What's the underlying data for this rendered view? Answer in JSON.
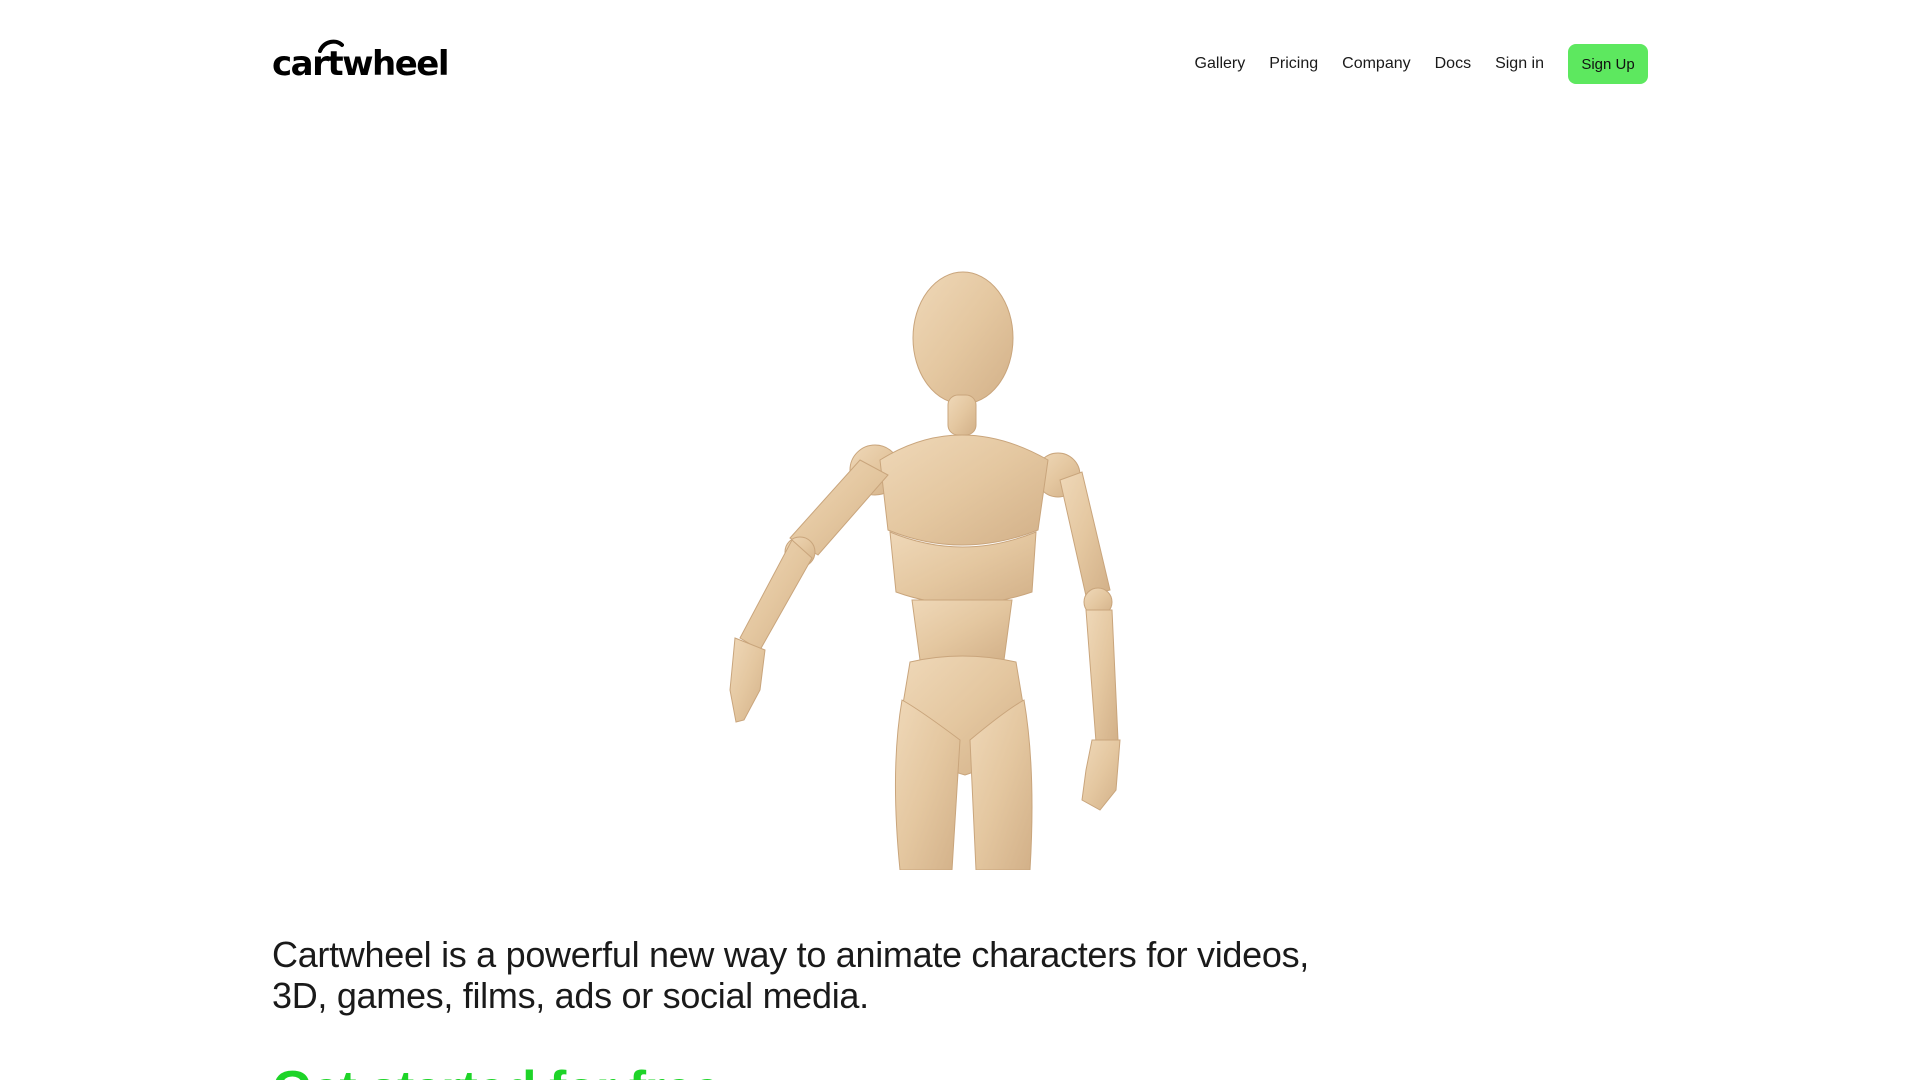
{
  "brand": {
    "logo_text": "cartwheel"
  },
  "nav": {
    "links": [
      "Gallery",
      "Pricing",
      "Company",
      "Docs",
      "Sign in"
    ],
    "signup_label": "Sign Up"
  },
  "hero": {
    "tagline": "Cartwheel is a powerful new way to animate characters for videos, 3D, games, films, ads or social media.",
    "cta_label": "Get started for free",
    "cta_icon": "arrow-right-icon"
  },
  "colors": {
    "accent": "#5de85f",
    "cta_text": "#1ed428",
    "mannequin_wood": "#e6cba6"
  }
}
